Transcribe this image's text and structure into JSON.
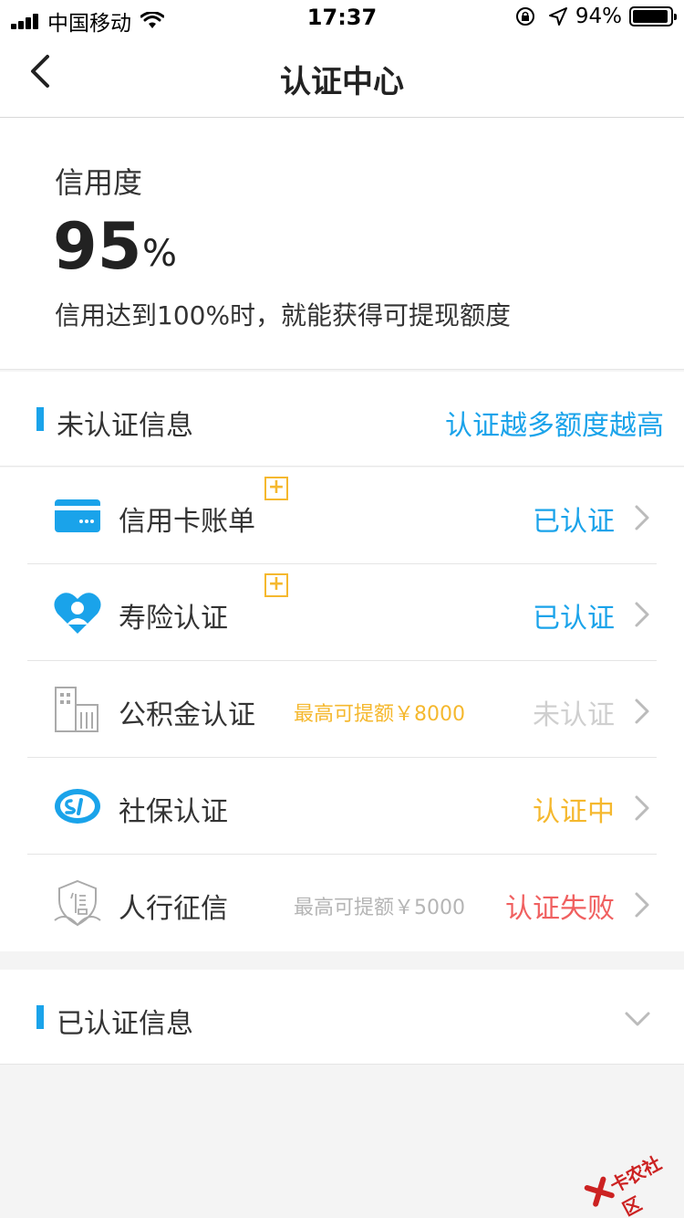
{
  "status_bar": {
    "carrier": "中国移动",
    "time": "17:37",
    "battery": "94%"
  },
  "nav": {
    "title": "认证中心"
  },
  "credit": {
    "title": "信用度",
    "value": "95",
    "unit": "%",
    "description": "信用达到100%时，就能获得可提现额度"
  },
  "unverified": {
    "title": "未认证信息",
    "link": "认证越多额度越高",
    "items": [
      {
        "label": "信用卡账单",
        "badge": "+",
        "quota": "",
        "status": "已认证",
        "status_color": "#1aa3ea"
      },
      {
        "label": "寿险认证",
        "badge": "+",
        "quota": "",
        "status": "已认证",
        "status_color": "#1aa3ea"
      },
      {
        "label": "公积金认证",
        "badge": "",
        "quota": "最高可提额￥8000",
        "quota_color": "#f5b82e",
        "status": "未认证",
        "status_color": "#cfcfcf"
      },
      {
        "label": "社保认证",
        "badge": "",
        "quota": "",
        "status": "认证中",
        "status_color": "#f5b82e"
      },
      {
        "label": "人行征信",
        "badge": "",
        "quota": "最高可提额￥5000",
        "quota_color": "#b5b5b5",
        "status": "认证失败",
        "status_color": "#f06060"
      }
    ]
  },
  "verified": {
    "title": "已认证信息"
  },
  "watermark": {
    "text": "卡农社区"
  },
  "colors": {
    "accent": "#1aa3ea",
    "warning": "#f5b82e",
    "error": "#f06060"
  }
}
